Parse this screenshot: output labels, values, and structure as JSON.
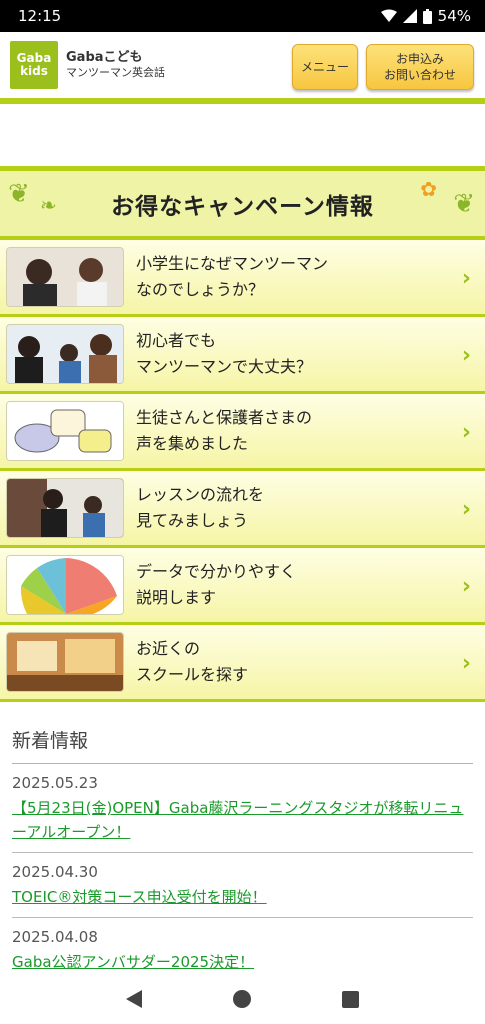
{
  "status": {
    "time": "12:15",
    "battery": "54%"
  },
  "header": {
    "logo_top": "Gaba",
    "logo_bottom": "kids",
    "brand_line1": "Gabaこども",
    "brand_line2": "マンツーマン英会話",
    "menu_label": "メニュー",
    "apply_line1": "お申込み",
    "apply_line2": "お問い合わせ"
  },
  "banner": {
    "title": "お得なキャンペーン情報"
  },
  "items": [
    {
      "text": "小学生になぜマンツーマン\nなのでしょうか？",
      "thumb": "teacher-child-photo"
    },
    {
      "text": "初心者でも\nマンツーマンで大丈夫？",
      "thumb": "family-photo"
    },
    {
      "text": "生徒さんと保護者さまの\n声を集めました",
      "thumb": "speech-bubbles"
    },
    {
      "text": "レッスンの流れを\n見てみましょう",
      "thumb": "lesson-photo"
    },
    {
      "text": "データで分かりやすく\n説明します",
      "thumb": "pie-chart"
    },
    {
      "text": "お近くの\nスクールを探す",
      "thumb": "school-photo"
    }
  ],
  "news": {
    "heading": "新着情報",
    "items": [
      {
        "date": "2025.05.23",
        "title": "【5月23日(金)OPEN】Gaba藤沢ラーニングスタジオが移転リニューアルオープン！"
      },
      {
        "date": "2025.04.30",
        "title": "TOEIC®対策コース申込受付を開始！"
      },
      {
        "date": "2025.04.08",
        "title": "Gaba公認アンバサダー2025決定！"
      }
    ]
  }
}
